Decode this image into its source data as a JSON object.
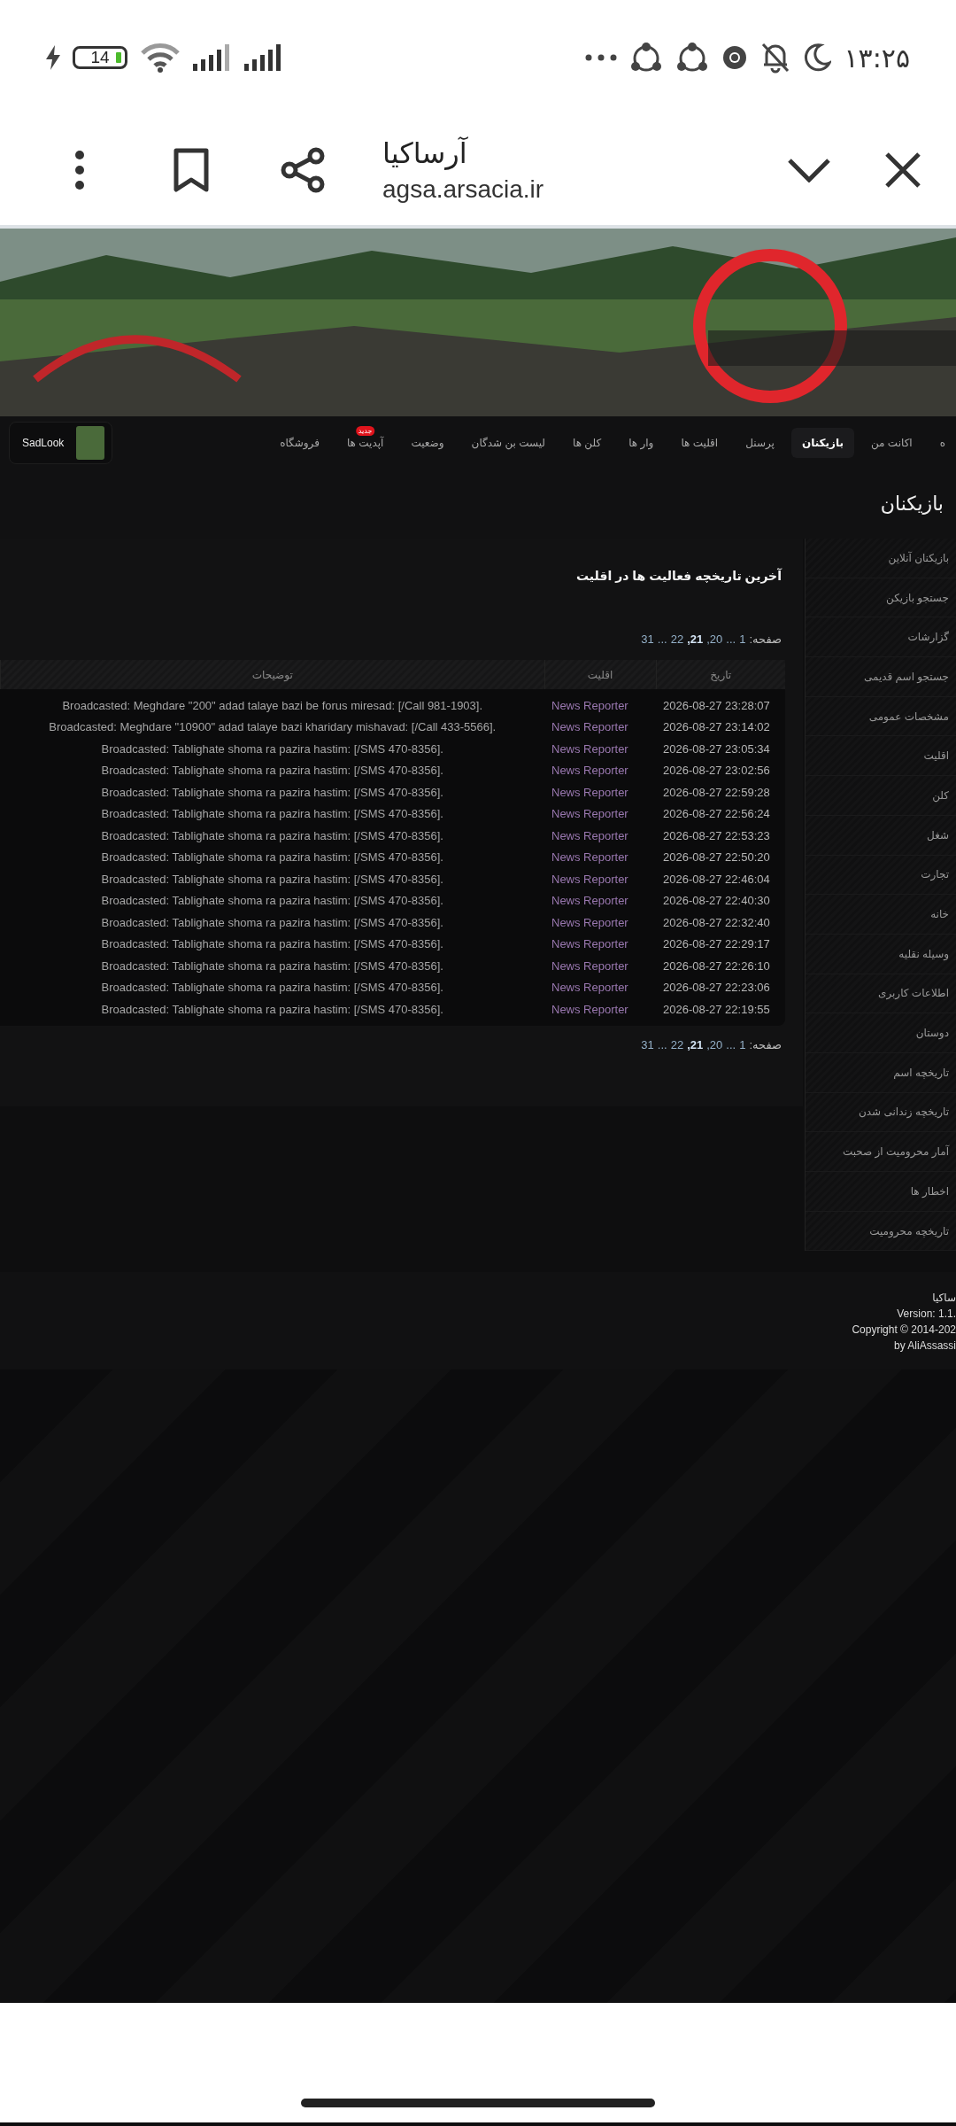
{
  "status_bar": {
    "time": "۱۳:۲۵",
    "battery": "14"
  },
  "browser": {
    "title": "آرساکیا",
    "url": "agsa.arsacia.ir"
  },
  "nav": {
    "user": "SadLook",
    "items": [
      {
        "label": "ه",
        "selected": false
      },
      {
        "label": "اکانت من",
        "selected": false
      },
      {
        "label": "بازیکنان",
        "selected": true
      },
      {
        "label": "پرسنل",
        "selected": false
      },
      {
        "label": "اقلیت ها",
        "selected": false
      },
      {
        "label": "وار ها",
        "selected": false
      },
      {
        "label": "کلن ها",
        "selected": false
      },
      {
        "label": "لیست بن شدگان",
        "selected": false
      },
      {
        "label": "وضعیت",
        "selected": false
      },
      {
        "label": "آپدیت ها",
        "selected": false,
        "badge": "جدید"
      },
      {
        "label": "فروشگاه",
        "selected": false
      }
    ]
  },
  "page_title": "بازیکنان",
  "sidebar": {
    "items": [
      "بازیکنان آنلاین",
      "جستجو بازیکن",
      "گزارشات",
      "جستجو اسم قدیمی",
      "مشخصات عمومی",
      "اقلیت",
      "کلن",
      "شغل",
      "تجارت",
      "خانه",
      "وسیله نقلیه",
      "اطلاعات کاربری",
      "دوستان",
      "تاریخچه اسم",
      "تاریخچه زندانی شدن",
      "آمار محرومیت از صحبت",
      "اخطار ها",
      "تاریخچه محرومیت"
    ]
  },
  "section_title": "آخرین تاریخچه فعالیت ها در اقلیت",
  "pagination_top": {
    "label": "صفحه:",
    "pages": [
      {
        "text": "1",
        "kind": "page",
        "selected": false
      },
      {
        "text": "...",
        "kind": "gap"
      },
      {
        "text": "20,",
        "kind": "page",
        "selected": false
      },
      {
        "text": "21,",
        "kind": "page",
        "selected": true
      },
      {
        "text": "22",
        "kind": "page",
        "selected": false
      },
      {
        "text": "...",
        "kind": "gap"
      },
      {
        "text": "31",
        "kind": "page",
        "selected": false
      }
    ]
  },
  "table": {
    "columns": [
      "تاریخ",
      "اقلیت",
      "توضیحات"
    ],
    "rows": [
      {
        "date": "2026-08-27 23:28:07",
        "faction": "News Reporter",
        "description": "Broadcasted: Meghdare \"200\" adad talaye bazi be forus miresad: [/Call 981-1903]."
      },
      {
        "date": "2026-08-27 23:14:02",
        "faction": "News Reporter",
        "description": "Broadcasted: Meghdare \"10900\" adad talaye bazi kharidary mishavad: [/Call 433-5566]."
      },
      {
        "date": "2026-08-27 23:05:34",
        "faction": "News Reporter",
        "description": "Broadcasted: Tablighate shoma ra pazira hastim: [/SMS 470-8356]."
      },
      {
        "date": "2026-08-27 23:02:56",
        "faction": "News Reporter",
        "description": "Broadcasted: Tablighate shoma ra pazira hastim: [/SMS 470-8356]."
      },
      {
        "date": "2026-08-27 22:59:28",
        "faction": "News Reporter",
        "description": "Broadcasted: Tablighate shoma ra pazira hastim: [/SMS 470-8356]."
      },
      {
        "date": "2026-08-27 22:56:24",
        "faction": "News Reporter",
        "description": "Broadcasted: Tablighate shoma ra pazira hastim: [/SMS 470-8356]."
      },
      {
        "date": "2026-08-27 22:53:23",
        "faction": "News Reporter",
        "description": "Broadcasted: Tablighate shoma ra pazira hastim: [/SMS 470-8356]."
      },
      {
        "date": "2026-08-27 22:50:20",
        "faction": "News Reporter",
        "description": "Broadcasted: Tablighate shoma ra pazira hastim: [/SMS 470-8356]."
      },
      {
        "date": "2026-08-27 22:46:04",
        "faction": "News Reporter",
        "description": "Broadcasted: Tablighate shoma ra pazira hastim: [/SMS 470-8356]."
      },
      {
        "date": "2026-08-27 22:40:30",
        "faction": "News Reporter",
        "description": "Broadcasted: Tablighate shoma ra pazira hastim: [/SMS 470-8356]."
      },
      {
        "date": "2026-08-27 22:32:40",
        "faction": "News Reporter",
        "description": "Broadcasted: Tablighate shoma ra pazira hastim: [/SMS 470-8356]."
      },
      {
        "date": "2026-08-27 22:29:17",
        "faction": "News Reporter",
        "description": "Broadcasted: Tablighate shoma ra pazira hastim: [/SMS 470-8356]."
      },
      {
        "date": "2026-08-27 22:26:10",
        "faction": "News Reporter",
        "description": "Broadcasted: Tablighate shoma ra pazira hastim: [/SMS 470-8356]."
      },
      {
        "date": "2026-08-27 22:23:06",
        "faction": "News Reporter",
        "description": "Broadcasted: Tablighate shoma ra pazira hastim: [/SMS 470-8356]."
      },
      {
        "date": "2026-08-27 22:19:55",
        "faction": "News Reporter",
        "description": "Broadcasted: Tablighate shoma ra pazira hastim: [/SMS 470-8356]."
      }
    ]
  },
  "pagination_bottom": {
    "label": "صفحه:",
    "pages": [
      {
        "text": "1",
        "kind": "page",
        "selected": false
      },
      {
        "text": "...",
        "kind": "gap"
      },
      {
        "text": "20,",
        "kind": "page",
        "selected": false
      },
      {
        "text": "21,",
        "kind": "page",
        "selected": true
      },
      {
        "text": "22",
        "kind": "page",
        "selected": false
      },
      {
        "text": "...",
        "kind": "gap"
      },
      {
        "text": "31",
        "kind": "page",
        "selected": false
      }
    ]
  },
  "footer": {
    "lines": [
      "ساکیا",
      "Version: 1.1.",
      "Copyright © 2014-202",
      "by AliAssassi"
    ]
  }
}
